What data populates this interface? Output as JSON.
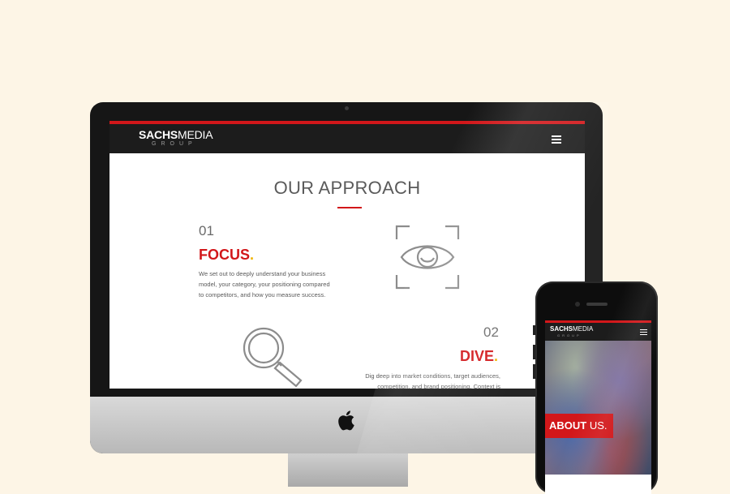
{
  "desktop": {
    "logo_bold": "SACHS",
    "logo_light": "MEDIA",
    "logo_group": "GROUP",
    "section_title": "OUR APPROACH",
    "steps": [
      {
        "number": "01",
        "name": "FOCUS",
        "dot": ".",
        "lines": [
          "We set out to deeply understand your business",
          "model, your category, your positioning compared",
          "to competitors, and how you measure success."
        ]
      },
      {
        "number": "02",
        "name": "DIVE",
        "dot": ".",
        "lines": [
          "Dig deep into market conditions, target audiences,",
          "competition, and brand positioning. Context is"
        ]
      }
    ]
  },
  "mobile": {
    "logo_bold": "SACHS",
    "logo_light": "MEDIA",
    "logo_group": "GROUP",
    "hero_heading_bold": "ABOUT",
    "hero_heading_light": " US."
  },
  "icons": {
    "menu": "hamburger-icon",
    "approach_focus": "eye-icon",
    "approach_dive": "magnifier-icon",
    "brand": "apple-logo"
  },
  "colors": {
    "accent_red": "#d2171a",
    "accent_yellow": "#f0b400",
    "header_dark": "#1c1c1c",
    "background": "#fdf5e6"
  }
}
